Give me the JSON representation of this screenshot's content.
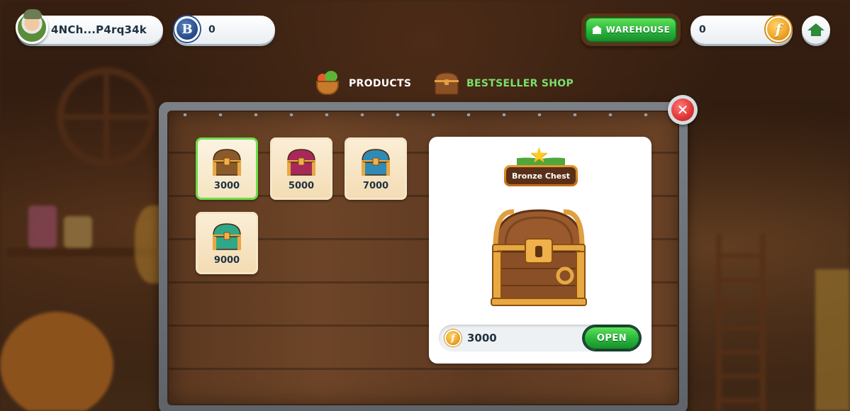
{
  "header": {
    "user_name": "4NCh...P4rq34k",
    "b_coin_symbol": "B",
    "b_balance": "0",
    "warehouse_label": "WAREHOUSE",
    "f_balance": "0",
    "f_coin_symbol": "f"
  },
  "tabs": [
    {
      "label": "PRODUCTS",
      "active": false,
      "icon": "basket-icon"
    },
    {
      "label": "BESTSELLER SHOP",
      "active": true,
      "icon": "chest-icon"
    }
  ],
  "chests": [
    {
      "price": "3000",
      "color": "#8a5a2a",
      "selected": true
    },
    {
      "price": "5000",
      "color": "#a8285a",
      "selected": false
    },
    {
      "price": "7000",
      "color": "#2f8ab4",
      "selected": false
    },
    {
      "price": "9000",
      "color": "#2fa88a",
      "selected": false
    }
  ],
  "detail": {
    "title": "Bronze Chest",
    "price": "3000",
    "coin_symbol": "f",
    "open_label": "OPEN"
  },
  "close_symbol": "✕",
  "colors": {
    "accent_green": "#5fdc4e",
    "text_dark": "#1f3140",
    "close_red": "#e23a3a"
  }
}
